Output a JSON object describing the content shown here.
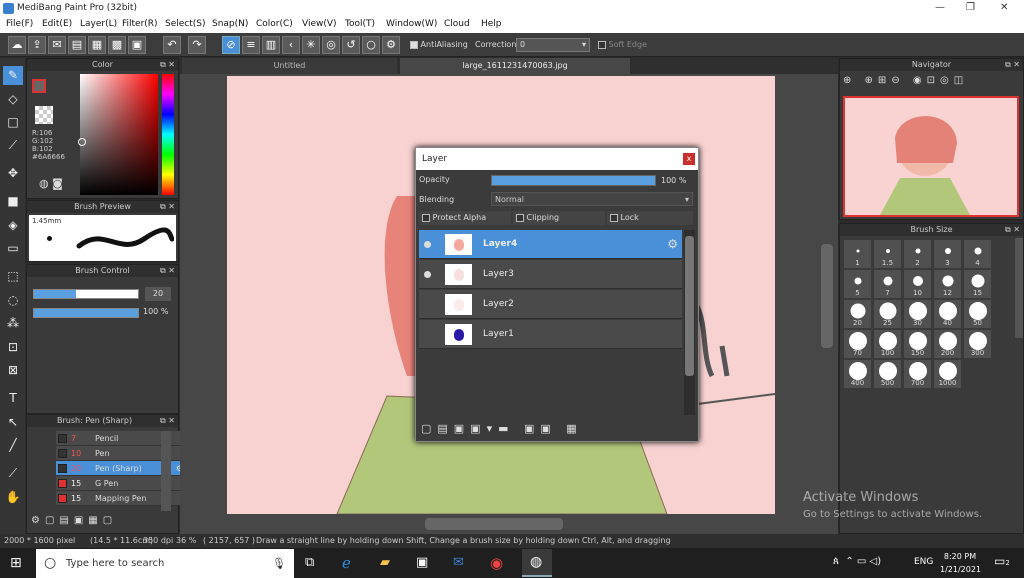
{
  "window": {
    "title": "MediBang Paint Pro (32bit)",
    "min": "—",
    "max": "❐",
    "close": "✕"
  },
  "menu": [
    "File(F)",
    "Edit(E)",
    "Layer(L)",
    "Filter(R)",
    "Select(S)",
    "Snap(N)",
    "Color(C)",
    "View(V)",
    "Tool(T)",
    "Window(W)",
    "Cloud",
    "Help"
  ],
  "toolbar": {
    "antialiasing": "AntiAliasing",
    "correction_label": "Correction",
    "correction_value": "0",
    "soft_edge": "Soft Edge"
  },
  "tabs": {
    "left": "Untitled",
    "right": "large_1611231470063.jpg"
  },
  "color_panel": {
    "title": "Color",
    "r": "R:106",
    "g": "G:102",
    "b": "B:102",
    "hex": "#6A6666",
    "fg": "#b03a3a",
    "bg": "#ffffff"
  },
  "brush_preview": {
    "title": "Brush Preview",
    "size": "1.45mm"
  },
  "brush_control": {
    "title": "Brush Control",
    "size_value": "20",
    "size_fraction": 0.4,
    "opacity_value": "100 %",
    "opacity_fraction": 1.0
  },
  "brush_list": {
    "title": "Brush: Pen (Sharp)",
    "items": [
      {
        "size": "7",
        "name": "Pencil",
        "color": "#333333"
      },
      {
        "size": "10",
        "name": "Pen",
        "color": "#333333"
      },
      {
        "size": "20",
        "name": "Pen (Sharp)",
        "color": "#333333",
        "selected": true
      },
      {
        "size": "15",
        "name": "G Pen",
        "color": "#e03030"
      },
      {
        "size": "15",
        "name": "Mapping Pen",
        "color": "#e03030"
      }
    ]
  },
  "layer_dialog": {
    "title": "Layer",
    "opacity_label": "Opacity",
    "opacity_value": "100 %",
    "opacity_fraction": 1.0,
    "blending_label": "Blending",
    "blending_value": "Normal",
    "protect_alpha": "Protect Alpha",
    "clipping": "Clipping",
    "lock": "Lock",
    "layers": [
      {
        "name": "Layer4",
        "selected": true,
        "visible": true
      },
      {
        "name": "Layer3",
        "selected": false,
        "visible": true
      },
      {
        "name": "Layer2",
        "selected": false,
        "visible": false
      },
      {
        "name": "Layer1",
        "selected": false,
        "visible": false
      }
    ]
  },
  "navigator": {
    "title": "Navigator"
  },
  "brush_size": {
    "title": "Brush Size",
    "sizes": [
      "1",
      "1.5",
      "2",
      "3",
      "4",
      "5",
      "7",
      "10",
      "12",
      "15",
      "20",
      "25",
      "30",
      "40",
      "50",
      "70",
      "100",
      "150",
      "200",
      "300",
      "400",
      "500",
      "700",
      "1000"
    ]
  },
  "status": {
    "dimensions": "2000 * 1600 pixel",
    "physical": "(14.5 * 11.6cm)",
    "dpi": "350 dpi",
    "zoom": "36 %",
    "coords": "( 2157, 657 )",
    "hint": "Draw a straight line by holding down Shift, Change a brush size by holding down Ctrl, Alt, and dragging"
  },
  "watermark": {
    "line1": "Activate Windows",
    "line2": "Go to Settings to activate Windows."
  },
  "taskbar": {
    "search_placeholder": "Type here to search",
    "time": "8:20 PM",
    "date": "1/21/2021",
    "lang": "ENG",
    "notif_count": "2"
  }
}
